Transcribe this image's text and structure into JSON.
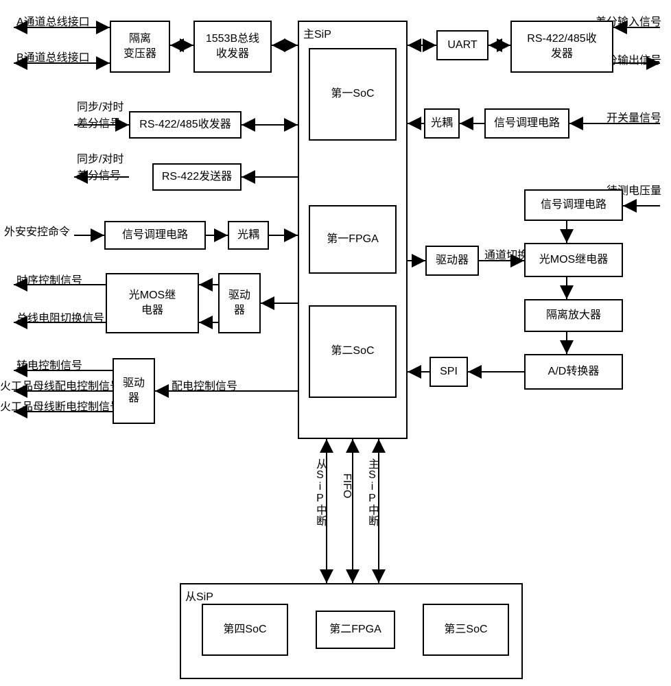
{
  "io_left": {
    "a_channel": "A通道总线接口",
    "b_channel": "B通道总线接口",
    "sync_diff_1": "同步/对时\n差分信号",
    "sync_diff_2": "同步/对时\n差分信号",
    "ext_safety_cmd": "外安安控命令",
    "timing_ctrl": "时序控制信号",
    "bus_res_switch": "总线电阻切换信号",
    "power_switch_ctrl": "转电控制信号",
    "pyro_bus_on": "火工品母线配电控制信号",
    "pyro_bus_off": "火工品母线断电控制信号",
    "power_ctrl_internal": "配电控制信号"
  },
  "io_right": {
    "diff_in": "差分输入信号",
    "diff_out": "差分输出信号",
    "switch_sig": "开关量信号",
    "voltage_to_measure": "待测电压量",
    "channel_switch": "通道切换"
  },
  "blocks": {
    "iso_trans": "隔离\n变压器",
    "bus_1553b": "1553B总线\n收发器",
    "rs422485_1": "RS-422/485收发器",
    "rs422_tx": "RS-422发送器",
    "sig_cond_left": "信号调理电路",
    "opto_left": "光耦",
    "optomos_left": "光MOS继\n电器",
    "driver_left1": "驱动\n器",
    "driver_left2": "驱动\n器",
    "uart": "UART",
    "rs422485_2": "RS-422/485收\n发器",
    "opto_right": "光耦",
    "sig_cond_right1": "信号调理电路",
    "driver_right": "驱动器",
    "sig_cond_right2": "信号调理电路",
    "optomos_right": "光MOS继电器",
    "iso_amp": "隔离放大器",
    "adc": "A/D转换器",
    "spi": "SPI"
  },
  "sip_main": {
    "title": "主SiP",
    "soc1": "第一SoC",
    "fpga1": "第一FPGA",
    "soc2": "第二SoC"
  },
  "sip_sub": {
    "title": "从SiP",
    "soc4": "第四SoC",
    "fpga2": "第二FPGA",
    "soc3": "第三SoC"
  },
  "interconnect": {
    "sub_sip_int": "从SiP中断",
    "fifo": "FIFO",
    "main_sip_int": "主SiP中断"
  }
}
